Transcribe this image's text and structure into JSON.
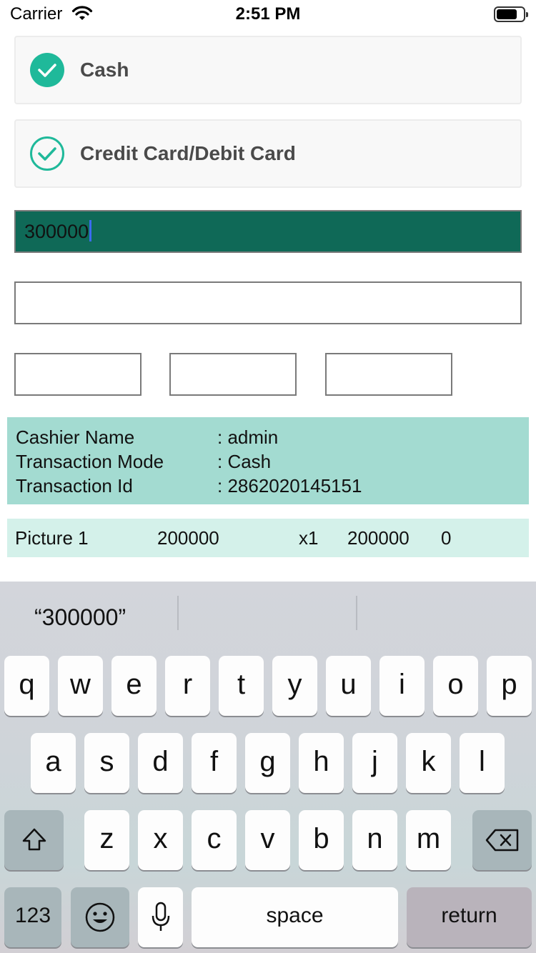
{
  "status_bar": {
    "carrier": "Carrier",
    "time": "2:51 PM"
  },
  "payment_options": [
    {
      "label": "Cash",
      "selected": true
    },
    {
      "label": "Credit Card/Debit Card",
      "selected": false
    }
  ],
  "amount_input": {
    "value": "300000"
  },
  "second_input": {
    "value": ""
  },
  "small_inputs": [
    {
      "value": ""
    },
    {
      "value": ""
    },
    {
      "value": ""
    }
  ],
  "transaction": {
    "rows": [
      {
        "key": "Cashier Name",
        "value": ": admin"
      },
      {
        "key": "Transaction Mode",
        "value": ": Cash"
      },
      {
        "key": "Transaction Id",
        "value": ": 2862020145151"
      }
    ]
  },
  "item": {
    "name": "Picture 1",
    "price": "200000",
    "qty": "x1",
    "total": "200000",
    "discount": "0"
  },
  "keyboard": {
    "suggestion": "“300000”",
    "row1": [
      "q",
      "w",
      "e",
      "r",
      "t",
      "y",
      "u",
      "i",
      "o",
      "p"
    ],
    "row2": [
      "a",
      "s",
      "d",
      "f",
      "g",
      "h",
      "j",
      "k",
      "l"
    ],
    "row3": [
      "z",
      "x",
      "c",
      "v",
      "b",
      "n",
      "m"
    ],
    "numbers_label": "123",
    "space_label": "space",
    "return_label": "return"
  },
  "colors": {
    "accent": "#1fb99a",
    "active_field": "#0f6957",
    "info_bg": "#a3dbd1",
    "item_bg": "#d4f1ea"
  }
}
